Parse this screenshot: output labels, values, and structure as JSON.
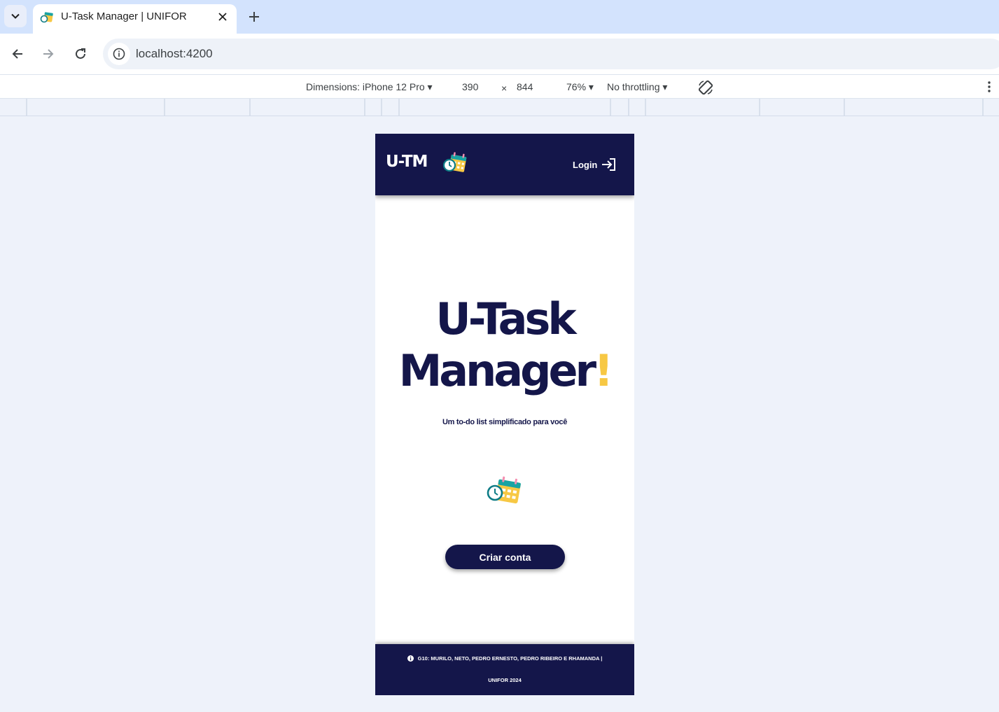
{
  "browser": {
    "tab_title": "U-Task Manager | UNIFOR",
    "url": "localhost:4200"
  },
  "devtools": {
    "dimensions_label": "Dimensions: iPhone 12 Pro",
    "width": "390",
    "times": "×",
    "height": "844",
    "zoom": "76%",
    "throttling": "No throttling"
  },
  "app": {
    "brand": "U-TM",
    "login_label": "Login",
    "hero_line1": "U-Task",
    "hero_line2": "Manager",
    "hero_bang": "!",
    "subtitle": "Um to-do list simplificado para você",
    "cta_label": "Criar conta",
    "footer_line1": "G10: MURILO, NETO, PEDRO ERNESTO, PEDRO RIBEIRO E RHAMANDA |",
    "footer_line2": "UNIFOR 2024"
  },
  "colors": {
    "navy": "#14164a",
    "accent_yellow": "#f7c844",
    "page_bg": "#eef2fa"
  },
  "icons": [
    "chevron-down-icon",
    "favicon-icon",
    "close-icon",
    "plus-icon",
    "back-icon",
    "forward-icon",
    "reload-icon",
    "info-icon",
    "rotate-icon",
    "kebab-icon",
    "calendar-clock-icon",
    "login-arrow-icon"
  ]
}
